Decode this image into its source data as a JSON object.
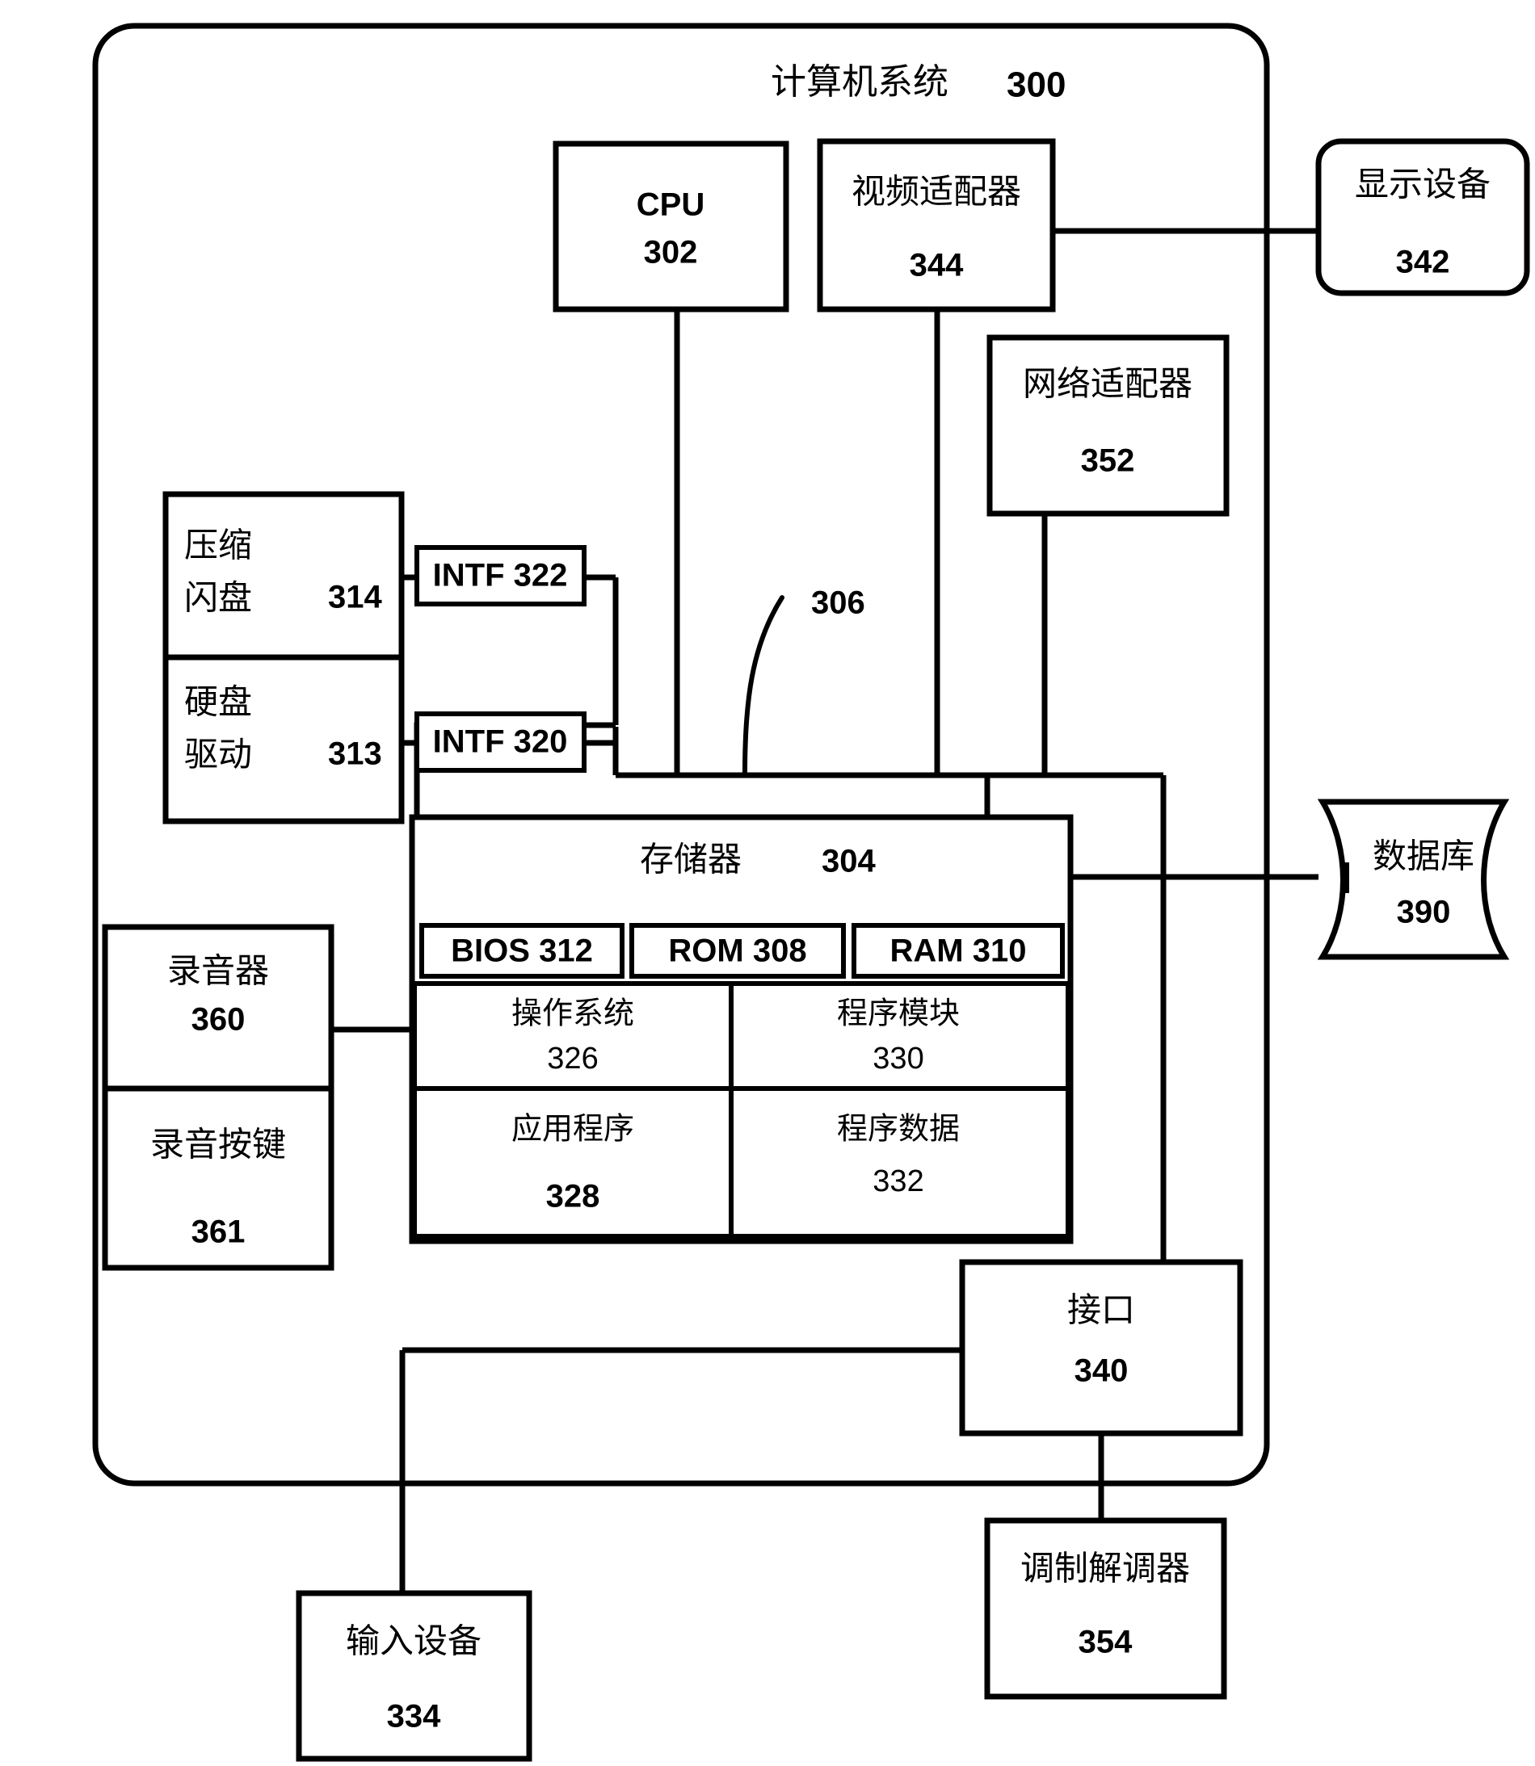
{
  "figure": {
    "title_label": "计算机系统",
    "title_ref": "300",
    "bus_ref": "306"
  },
  "blocks": {
    "cpu": {
      "label": "CPU",
      "ref": "302"
    },
    "video_adapter": {
      "label": "视频适配器",
      "ref": "344"
    },
    "display_device": {
      "label": "显示设备",
      "ref": "342"
    },
    "network_adapter": {
      "label": "网络适配器",
      "ref": "352"
    },
    "flash_disk": {
      "label_line1": "压缩",
      "label_line2": "闪盘",
      "ref": "314"
    },
    "hard_disk": {
      "label_line1": "硬盘",
      "label_line2": "驱动",
      "ref": "313"
    },
    "intf_322": {
      "label": "INTF 322"
    },
    "intf_320": {
      "label": "INTF 320"
    },
    "memory": {
      "label": "存储器",
      "ref": "304"
    },
    "bios": {
      "label": "BIOS 312"
    },
    "rom": {
      "label": "ROM 308"
    },
    "ram": {
      "label": "RAM 310"
    },
    "operating_system": {
      "label": "操作系统",
      "ref": "326"
    },
    "program_modules": {
      "label": "程序模块",
      "ref": "330"
    },
    "application_programs": {
      "label": "应用程序",
      "ref": "328"
    },
    "program_data": {
      "label": "程序数据",
      "ref": "332"
    },
    "recorder": {
      "label": "录音器",
      "ref": "360"
    },
    "record_button": {
      "label": "录音按键",
      "ref": "361"
    },
    "database": {
      "label": "数据库",
      "ref": "390"
    },
    "interface": {
      "label": "接口",
      "ref": "340"
    },
    "modem": {
      "label": "调制解调器",
      "ref": "354"
    },
    "input_device": {
      "label": "输入设备",
      "ref": "334"
    }
  },
  "colors": {
    "stroke": "#000000",
    "background": "#ffffff"
  }
}
